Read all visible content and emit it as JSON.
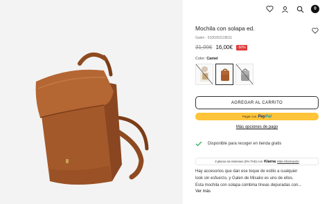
{
  "header": {
    "icons": [
      "heart-icon",
      "user-icon",
      "search-icon",
      "cart-icon"
    ],
    "cart_count": "0"
  },
  "product": {
    "title": "Mochila con solapa ed.",
    "meta": "Galen - 5100352118011",
    "old_price": "31,99€",
    "price": "16,00€",
    "discount": "-50%",
    "color_label": "Color:",
    "color_value": "Camel",
    "swatches": [
      {
        "name": "white-model",
        "color": "#e8e3dc",
        "selected": false,
        "unavailable": true
      },
      {
        "name": "camel",
        "color": "#a45a2a",
        "selected": true,
        "unavailable": false
      },
      {
        "name": "grey",
        "color": "#9c9c9c",
        "selected": false,
        "unavailable": true
      }
    ]
  },
  "actions": {
    "add_to_cart": "AGREGAR AL CARRITO",
    "paypal_prefix": "Pagar con",
    "paypal_logo_a": "Pay",
    "paypal_logo_b": "Pal",
    "more_payment": "Más opciones de pago"
  },
  "pickup": {
    "text": "Disponible para recoger en tienda gratis"
  },
  "klarna": {
    "prefix": "3 plazos sin intereses (0% TAE) con",
    "logo": "Klarna",
    "link": "Más información"
  },
  "description": {
    "line1": "Hay accesorios que dan ese toque de estilo a cualquier",
    "line2": "look sin esfuerzo, y Galen de Misako es uno de ellos.",
    "line3": "Esta mochila con solapa combina líneas depuradas con...",
    "see_more": "Ver más"
  },
  "colors": {
    "accent_red": "#e03a3a",
    "paypal_yellow": "#ffc439",
    "check_green": "#2fae5d",
    "bag_camel": "#a45a2a"
  }
}
